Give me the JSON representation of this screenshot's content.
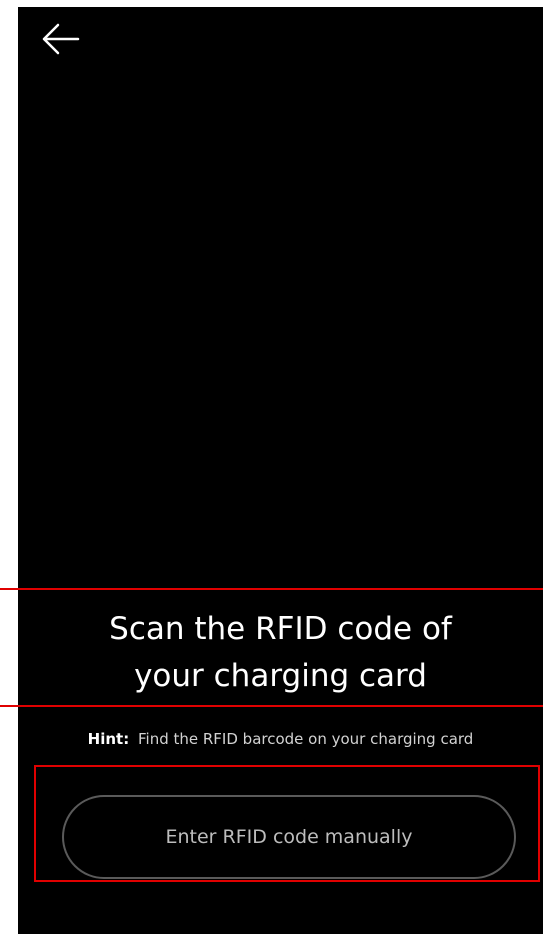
{
  "nav": {
    "back_icon": "arrow-left-icon"
  },
  "scan": {
    "title_line1": "Scan the RFID code of",
    "title_line2": "your charging card"
  },
  "hint": {
    "label": "Hint:",
    "text": "Find the RFID barcode on your charging card"
  },
  "actions": {
    "manual_entry_label": "Enter RFID code manually"
  },
  "colors": {
    "background": "#000000",
    "highlight": "#e00000",
    "button_border": "#5a5a5a"
  }
}
